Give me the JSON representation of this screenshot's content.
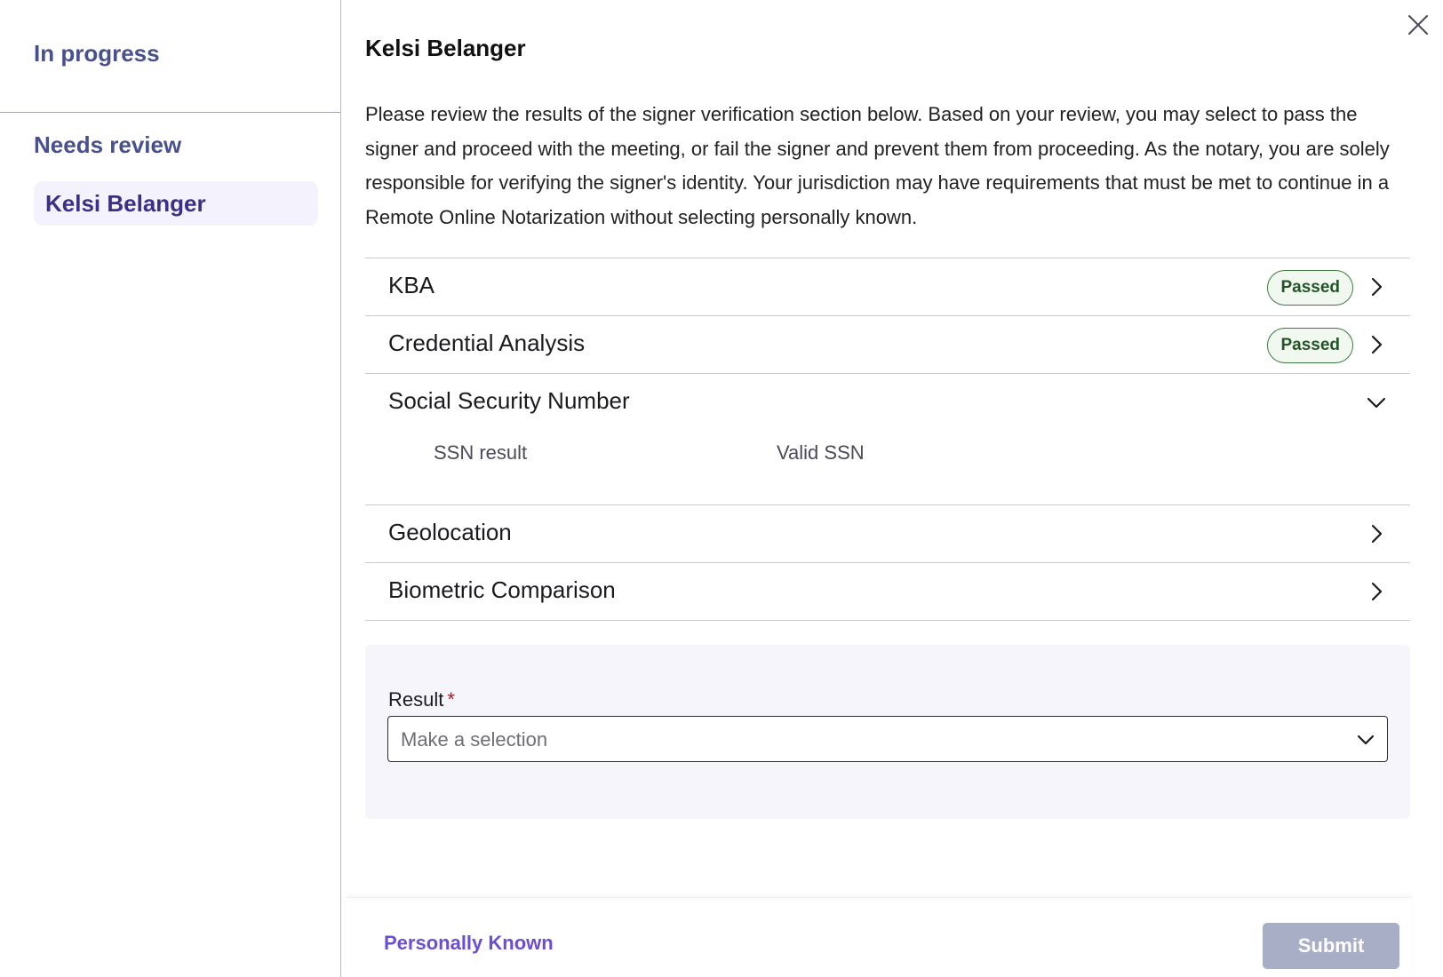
{
  "sidebar": {
    "in_progress_heading": "In progress",
    "needs_review_heading": "Needs review",
    "items": [
      {
        "label": "Kelsi Belanger"
      }
    ]
  },
  "main": {
    "signer_name": "Kelsi Belanger",
    "description": "Please review the results of the signer verification section below. Based on your review, you may select to pass the signer and proceed with the meeting, or fail the signer and prevent them from proceeding. As the notary, you are solely responsible for verifying the signer's identity. Your jurisdiction may have requirements that must be met to continue in a Remote Online Notarization without selecting personally known.",
    "sections": [
      {
        "title": "KBA",
        "badge": "Passed",
        "icon": "chevron-right-icon"
      },
      {
        "title": "Credential Analysis",
        "badge": "Passed",
        "icon": "chevron-right-icon"
      },
      {
        "title": "Social Security Number",
        "icon": "chevron-down-icon",
        "detail_label": "SSN result",
        "detail_value": "Valid SSN"
      },
      {
        "title": "Geolocation",
        "icon": "chevron-right-icon"
      },
      {
        "title": "Biometric Comparison",
        "icon": "chevron-right-icon"
      }
    ],
    "result": {
      "label": "Result",
      "required_marker": "*",
      "placeholder": "Make a selection"
    }
  },
  "footer": {
    "personally_known_label": "Personally Known",
    "submit_label": "Submit"
  },
  "colors": {
    "accent_purple": "#6c4ed1",
    "sidebar_heading": "#49508e",
    "passed_badge_border": "#3e7a40",
    "submit_disabled": "#a8aec5"
  }
}
